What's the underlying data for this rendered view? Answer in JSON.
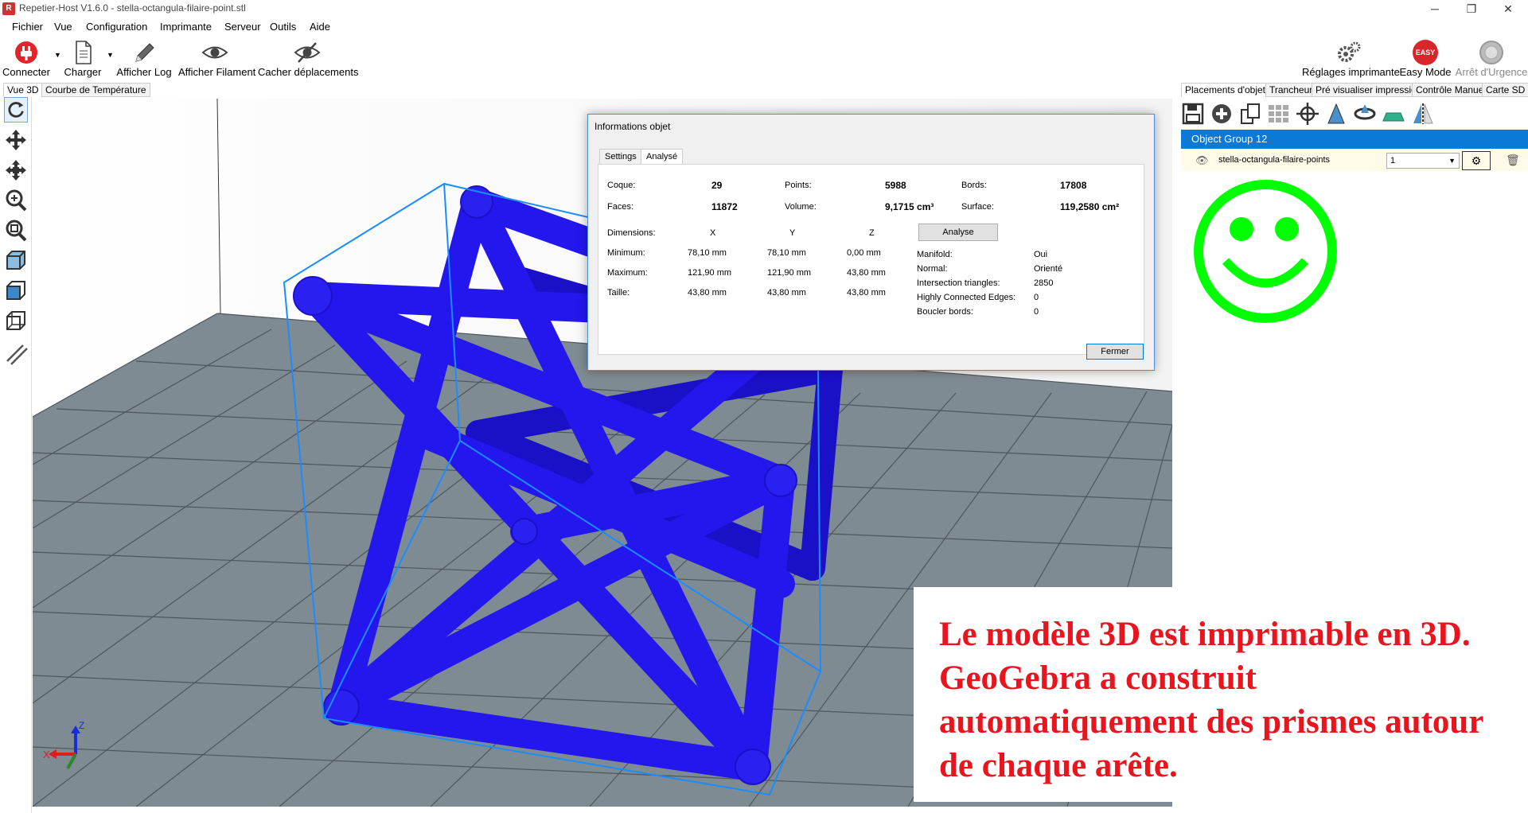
{
  "window": {
    "title": "Repetier-Host V1.6.0 - stella-octangula-filaire-point.stl",
    "app_icon_text": "R"
  },
  "menu": [
    "Fichier",
    "Vue",
    "Configuration",
    "Imprimante",
    "Serveur",
    "Outils",
    "Aide"
  ],
  "toolbar": {
    "connect": "Connecter",
    "load": "Charger",
    "show_log": "Afficher Log",
    "show_filament": "Afficher Filament",
    "hide_moves": "Cacher  déplacements",
    "printer_settings": "Réglages imprimante",
    "easy_mode": "Easy Mode",
    "easy_badge": "EASY",
    "emergency_stop": "Arrêt d'Urgence"
  },
  "view_tabs": [
    "Vue 3D",
    "Courbe de Température"
  ],
  "right_tabs": [
    "Placements d'objets",
    "Trancheur",
    "Pré visualiser impression",
    "Contrôle Manuel",
    "Carte SD"
  ],
  "object_panel": {
    "group_name": "Object Group  12",
    "object_name": "stella-octangula-filaire-points",
    "copies": "1"
  },
  "dialog": {
    "title": "Informations objet",
    "tabs": [
      "Settings",
      "Analysé"
    ],
    "stats": {
      "shell_label": "Coque:",
      "shell_value": "29",
      "points_label": "Points:",
      "points_value": "5988",
      "edges_label": "Bords:",
      "edges_value": "17808",
      "faces_label": "Faces:",
      "faces_value": "11872",
      "volume_label": "Volume:",
      "volume_value": "9,1715 cm³",
      "surface_label": "Surface:",
      "surface_value": "119,2580 cm²"
    },
    "dimensions": {
      "label": "Dimensions:",
      "headers": [
        "X",
        "Y",
        "Z"
      ],
      "rows": [
        {
          "label": "Minimum:",
          "x": "78,10 mm",
          "y": "78,10 mm",
          "z": "0,00 mm"
        },
        {
          "label": "Maximum:",
          "x": "121,90 mm",
          "y": "121,90 mm",
          "z": "43,80 mm"
        },
        {
          "label": "Taille:",
          "x": "43,80 mm",
          "y": "43,80 mm",
          "z": "43,80 mm"
        }
      ]
    },
    "analyse_button": "Analyse",
    "analysis": [
      {
        "label": "Manifold:",
        "value": "Oui"
      },
      {
        "label": "Normal:",
        "value": "Orienté"
      },
      {
        "label": "Intersection triangles:",
        "value": "2850"
      },
      {
        "label": "Highly Connected Edges:",
        "value": "0"
      },
      {
        "label": "Boucler bords:",
        "value": "0"
      }
    ],
    "close_button": "Fermer"
  },
  "axes": {
    "x": "X",
    "z": "Z"
  },
  "overlay_text": "Le modèle 3D est imprimable en 3D. GeoGebra a construit automatiquement des prismes autour de chaque arête.",
  "colors": {
    "model": "#1a10e0",
    "bbox": "#1a8cff",
    "floor": "#7f8b93",
    "smiley": "#00ff00",
    "group_header": "#0a7ad6",
    "overlay_text": "#e8141e"
  }
}
